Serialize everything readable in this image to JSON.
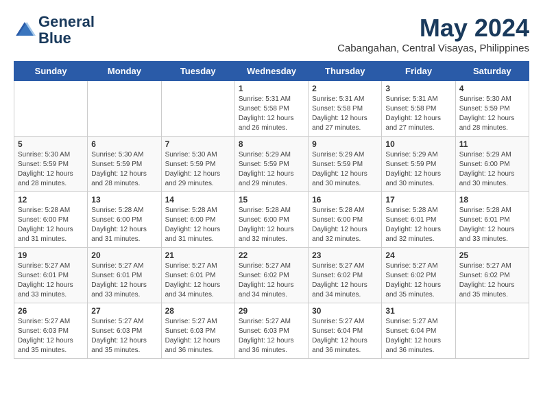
{
  "logo": {
    "name": "General",
    "name2": "Blue"
  },
  "title": "May 2024",
  "subtitle": "Cabangahan, Central Visayas, Philippines",
  "days_of_week": [
    "Sunday",
    "Monday",
    "Tuesday",
    "Wednesday",
    "Thursday",
    "Friday",
    "Saturday"
  ],
  "weeks": [
    [
      {
        "day": "",
        "sunrise": "",
        "sunset": "",
        "daylight": ""
      },
      {
        "day": "",
        "sunrise": "",
        "sunset": "",
        "daylight": ""
      },
      {
        "day": "",
        "sunrise": "",
        "sunset": "",
        "daylight": ""
      },
      {
        "day": "1",
        "sunrise": "5:31 AM",
        "sunset": "5:58 PM",
        "daylight": "12 hours and 26 minutes."
      },
      {
        "day": "2",
        "sunrise": "5:31 AM",
        "sunset": "5:58 PM",
        "daylight": "12 hours and 27 minutes."
      },
      {
        "day": "3",
        "sunrise": "5:31 AM",
        "sunset": "5:58 PM",
        "daylight": "12 hours and 27 minutes."
      },
      {
        "day": "4",
        "sunrise": "5:30 AM",
        "sunset": "5:59 PM",
        "daylight": "12 hours and 28 minutes."
      }
    ],
    [
      {
        "day": "5",
        "sunrise": "5:30 AM",
        "sunset": "5:59 PM",
        "daylight": "12 hours and 28 minutes."
      },
      {
        "day": "6",
        "sunrise": "5:30 AM",
        "sunset": "5:59 PM",
        "daylight": "12 hours and 28 minutes."
      },
      {
        "day": "7",
        "sunrise": "5:30 AM",
        "sunset": "5:59 PM",
        "daylight": "12 hours and 29 minutes."
      },
      {
        "day": "8",
        "sunrise": "5:29 AM",
        "sunset": "5:59 PM",
        "daylight": "12 hours and 29 minutes."
      },
      {
        "day": "9",
        "sunrise": "5:29 AM",
        "sunset": "5:59 PM",
        "daylight": "12 hours and 30 minutes."
      },
      {
        "day": "10",
        "sunrise": "5:29 AM",
        "sunset": "5:59 PM",
        "daylight": "12 hours and 30 minutes."
      },
      {
        "day": "11",
        "sunrise": "5:29 AM",
        "sunset": "6:00 PM",
        "daylight": "12 hours and 30 minutes."
      }
    ],
    [
      {
        "day": "12",
        "sunrise": "5:28 AM",
        "sunset": "6:00 PM",
        "daylight": "12 hours and 31 minutes."
      },
      {
        "day": "13",
        "sunrise": "5:28 AM",
        "sunset": "6:00 PM",
        "daylight": "12 hours and 31 minutes."
      },
      {
        "day": "14",
        "sunrise": "5:28 AM",
        "sunset": "6:00 PM",
        "daylight": "12 hours and 31 minutes."
      },
      {
        "day": "15",
        "sunrise": "5:28 AM",
        "sunset": "6:00 PM",
        "daylight": "12 hours and 32 minutes."
      },
      {
        "day": "16",
        "sunrise": "5:28 AM",
        "sunset": "6:00 PM",
        "daylight": "12 hours and 32 minutes."
      },
      {
        "day": "17",
        "sunrise": "5:28 AM",
        "sunset": "6:01 PM",
        "daylight": "12 hours and 32 minutes."
      },
      {
        "day": "18",
        "sunrise": "5:28 AM",
        "sunset": "6:01 PM",
        "daylight": "12 hours and 33 minutes."
      }
    ],
    [
      {
        "day": "19",
        "sunrise": "5:27 AM",
        "sunset": "6:01 PM",
        "daylight": "12 hours and 33 minutes."
      },
      {
        "day": "20",
        "sunrise": "5:27 AM",
        "sunset": "6:01 PM",
        "daylight": "12 hours and 33 minutes."
      },
      {
        "day": "21",
        "sunrise": "5:27 AM",
        "sunset": "6:01 PM",
        "daylight": "12 hours and 34 minutes."
      },
      {
        "day": "22",
        "sunrise": "5:27 AM",
        "sunset": "6:02 PM",
        "daylight": "12 hours and 34 minutes."
      },
      {
        "day": "23",
        "sunrise": "5:27 AM",
        "sunset": "6:02 PM",
        "daylight": "12 hours and 34 minutes."
      },
      {
        "day": "24",
        "sunrise": "5:27 AM",
        "sunset": "6:02 PM",
        "daylight": "12 hours and 35 minutes."
      },
      {
        "day": "25",
        "sunrise": "5:27 AM",
        "sunset": "6:02 PM",
        "daylight": "12 hours and 35 minutes."
      }
    ],
    [
      {
        "day": "26",
        "sunrise": "5:27 AM",
        "sunset": "6:03 PM",
        "daylight": "12 hours and 35 minutes."
      },
      {
        "day": "27",
        "sunrise": "5:27 AM",
        "sunset": "6:03 PM",
        "daylight": "12 hours and 35 minutes."
      },
      {
        "day": "28",
        "sunrise": "5:27 AM",
        "sunset": "6:03 PM",
        "daylight": "12 hours and 36 minutes."
      },
      {
        "day": "29",
        "sunrise": "5:27 AM",
        "sunset": "6:03 PM",
        "daylight": "12 hours and 36 minutes."
      },
      {
        "day": "30",
        "sunrise": "5:27 AM",
        "sunset": "6:04 PM",
        "daylight": "12 hours and 36 minutes."
      },
      {
        "day": "31",
        "sunrise": "5:27 AM",
        "sunset": "6:04 PM",
        "daylight": "12 hours and 36 minutes."
      },
      {
        "day": "",
        "sunrise": "",
        "sunset": "",
        "daylight": ""
      }
    ]
  ]
}
